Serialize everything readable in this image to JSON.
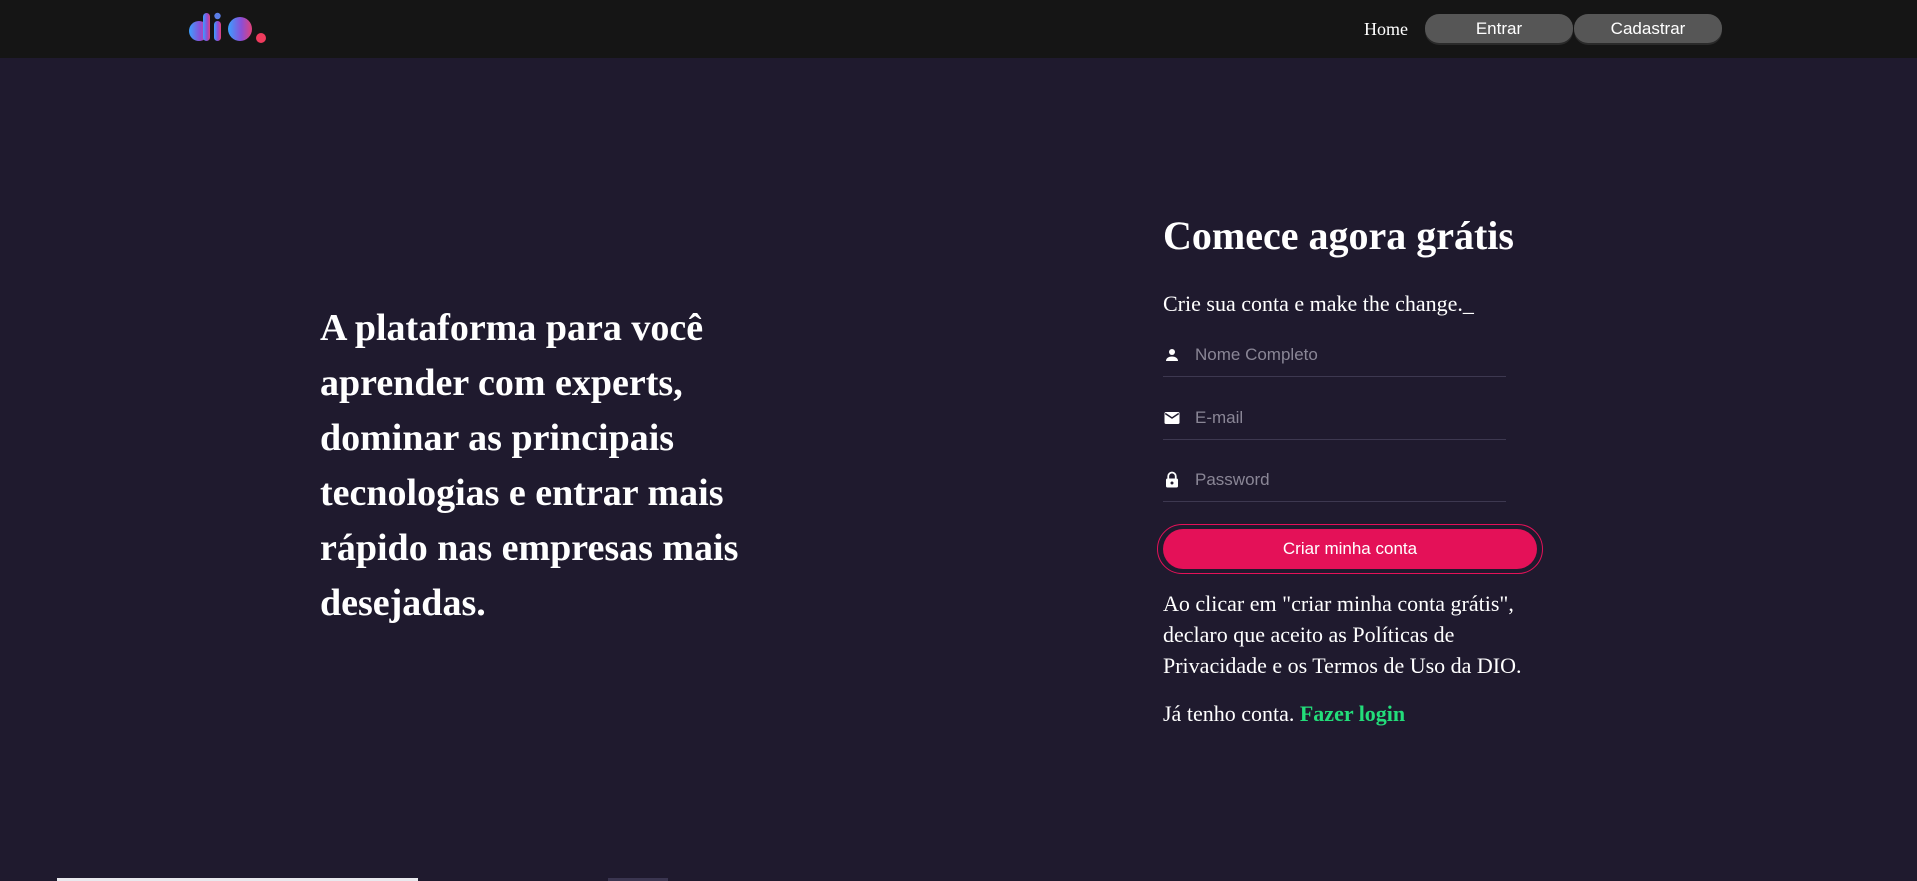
{
  "header": {
    "logo_text": "dio.",
    "nav_home": "Home",
    "btn_entrar": "Entrar",
    "btn_cadastrar": "Cadastrar"
  },
  "hero": {
    "text": "A plataforma para você aprender com experts, dominar as principais tecnologias e entrar mais rápido nas empresas mais desejadas."
  },
  "signup": {
    "title": "Comece agora grátis",
    "subtitle": "Crie sua conta e make the change._",
    "name_placeholder": "Nome Completo",
    "email_placeholder": "E-mail",
    "password_placeholder": "Password",
    "submit_label": "Criar minha conta",
    "terms": "Ao clicar em \"criar minha conta grátis\", declaro que aceito as Políticas de Privacidade e os Termos de Uso da DIO.",
    "have_account": "Já tenho conta.",
    "login_link": "Fazer login"
  },
  "icons": {
    "name_field": "person-icon",
    "email_field": "mail-icon",
    "password_field": "lock-icon"
  },
  "colors": {
    "background": "#1f1a2e",
    "topbar": "#151515",
    "accent": "#e41158",
    "link": "#23dd7a",
    "nav_button": "#565656"
  }
}
